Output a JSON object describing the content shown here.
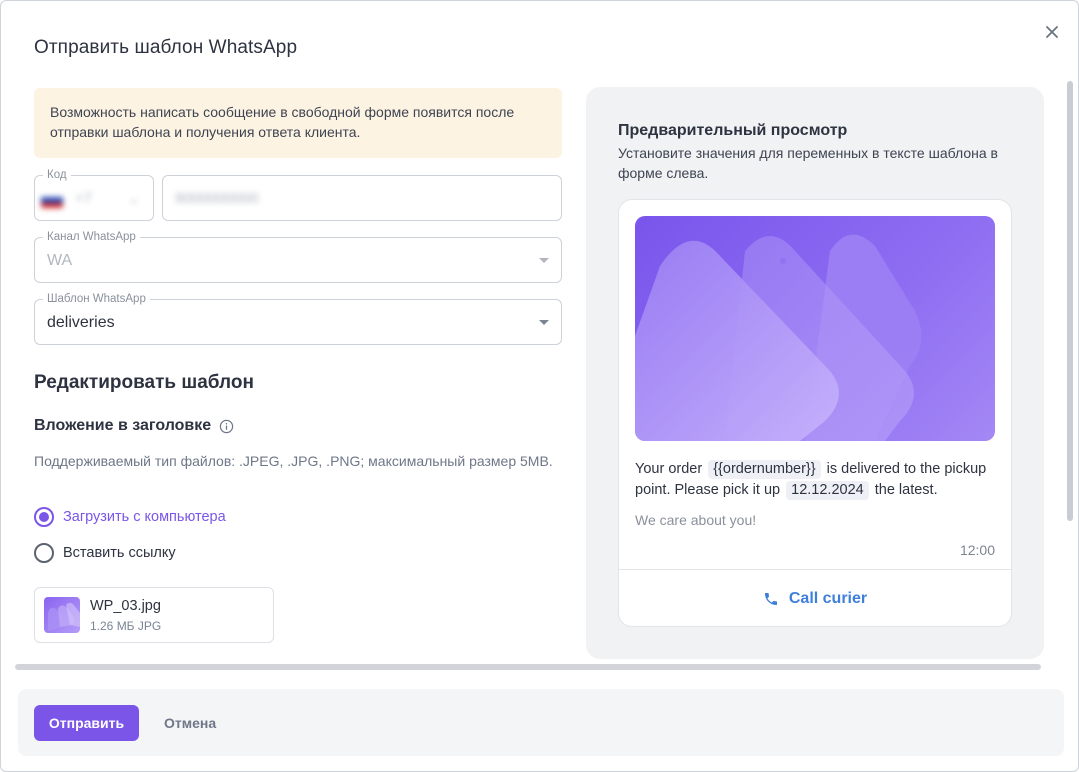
{
  "dialog": {
    "title": "Отправить шаблон WhatsApp",
    "notice": "Возможность написать сообщение в свободной форме появится после отправки шаблона и получения ответа клиента."
  },
  "form": {
    "code_label": "Код",
    "code_value": "+7",
    "phone_value": "9000000000",
    "channel_label": "Канал WhatsApp",
    "channel_value": "WA",
    "template_label": "Шаблон WhatsApp",
    "template_value": "deliveries"
  },
  "edit": {
    "heading": "Редактировать шаблон",
    "attachment_heading": "Вложение в заголовке",
    "attachment_hint": "Поддерживаемый тип файлов: .JPEG, .JPG, .PNG; максимальный размер 5MB.",
    "radio_upload": "Загрузить с компьютера",
    "radio_link": "Вставить ссылку",
    "file_name": "WP_03.jpg",
    "file_meta": "1.26 МБ JPG"
  },
  "preview": {
    "title": "Предварительный просмотр",
    "subtitle": "Установите значения для переменных в тексте шаблона в форме слева.",
    "text_part1": "Your order",
    "var_order": "{{ordernumber}}",
    "text_part2": "is delivered to the pickup point. Please pick it up",
    "var_date": "12.12.2024",
    "text_part3": "the latest.",
    "footer": "We care about you!",
    "time": "12:00",
    "button_label": "Call curier"
  },
  "actions": {
    "send_label": "Отправить",
    "cancel_label": "Отмена"
  },
  "colors": {
    "accent": "#7b55e8",
    "link_blue": "#3f7fdc",
    "notice_bg": "#fdf3e2"
  }
}
